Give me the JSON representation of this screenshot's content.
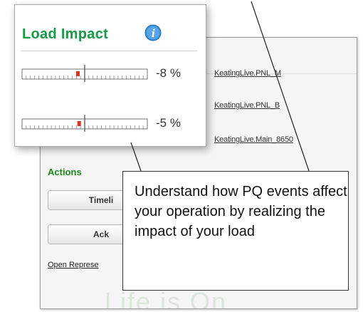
{
  "load_impact": {
    "title": "Load Impact",
    "gauges": [
      {
        "value_text": "-8 %",
        "level_fraction": 0.46
      },
      {
        "value_text": "-5 %",
        "level_fraction": 0.47
      }
    ]
  },
  "links": [
    "KeatingLive.PNL_M",
    "KeatingLive.PNL_B",
    "KeatingLive.Main_8650"
  ],
  "actions": {
    "heading": "Actions",
    "buttons": [
      "Timeli",
      "Ack"
    ],
    "open_link": "Open Represe"
  },
  "callout": {
    "text": "Understand how PQ events affect your operation by realizing the impact of your load"
  },
  "brand": {
    "partial_text": "Life is On",
    "green_letter": "e"
  },
  "colors": {
    "title_green": "#169a46",
    "actions_green": "#1a8a1a",
    "marker_red": "#d9341f",
    "info_blue": "#3a8fd8"
  }
}
